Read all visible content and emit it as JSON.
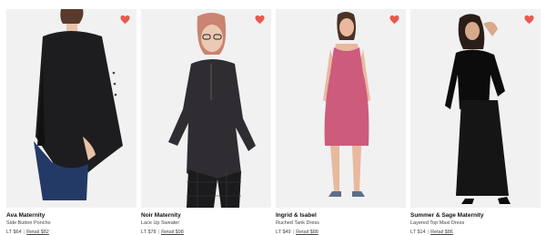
{
  "products": [
    {
      "brand": "Ava Maternity",
      "name": "Side Button Poncho",
      "lt_price": "LT $64",
      "retail_price": "Retail $82",
      "garment_color": "#1d1d1f",
      "accent_color": "#243a66",
      "favorite_color": "#e85a4f"
    },
    {
      "brand": "Noir Maternity",
      "name": "Lace Up Sweater",
      "lt_price": "LT $78",
      "retail_price": "Retail $98",
      "garment_color": "#2f2d31",
      "accent_color": "#1b1b1d",
      "favorite_color": "#e85a4f"
    },
    {
      "brand": "Ingrid & Isabel",
      "name": "Ruched Tank Dress",
      "lt_price": "LT $49",
      "retail_price": "Retail $88",
      "garment_color": "#cc5b7c",
      "accent_color": "#e8b99f",
      "favorite_color": "#e85a4f"
    },
    {
      "brand": "Summer & Sage Maternity",
      "name": "Layered Top Maxi Dress",
      "lt_price": "LT $14",
      "retail_price": "Retail $86",
      "garment_color": "#151515",
      "accent_color": "#0c0c0c",
      "favorite_color": "#e85a4f"
    }
  ]
}
